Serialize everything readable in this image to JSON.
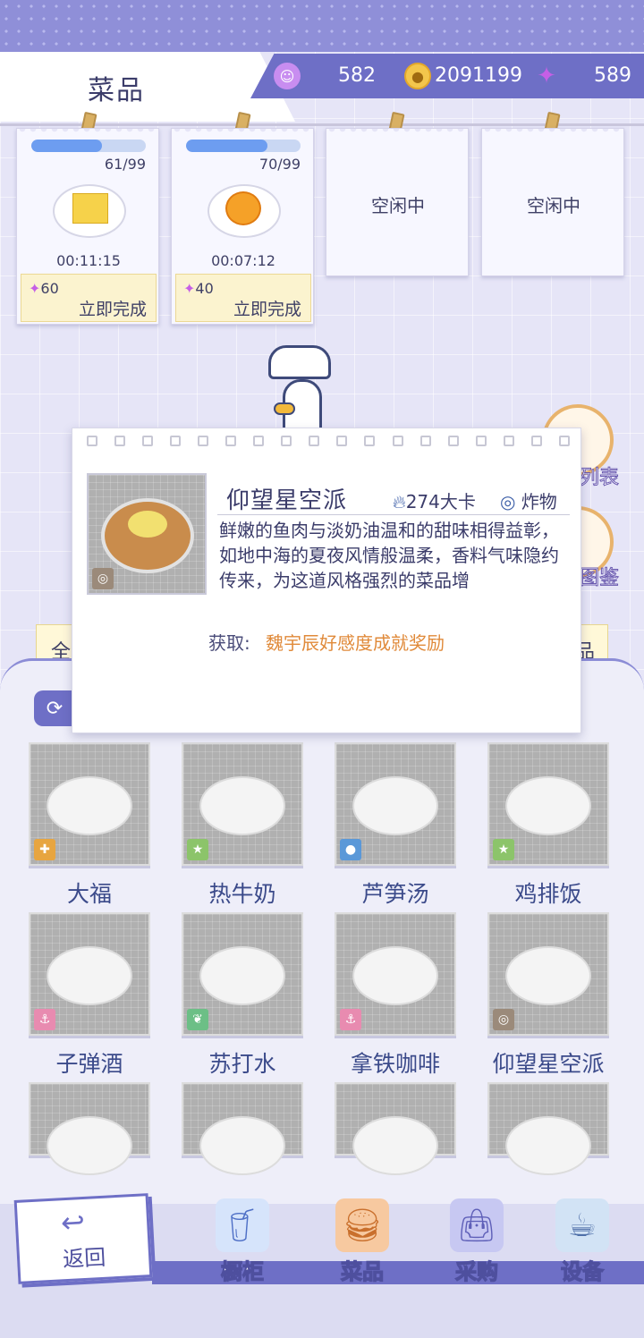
{
  "header": {
    "title": "菜品",
    "resources": [
      {
        "icon": "smile-gem-icon",
        "value": "582"
      },
      {
        "icon": "coin-icon",
        "value": "2091199"
      },
      {
        "icon": "crystal-plus-icon",
        "value": "589"
      }
    ]
  },
  "slots": [
    {
      "state": "cooking",
      "count": "61/99",
      "progress": 0.62,
      "timer": "00:11:15",
      "cost": "60",
      "finish_label": "立即完成",
      "dish_icon": "butter-plate-icon"
    },
    {
      "state": "cooking",
      "count": "70/99",
      "progress": 0.71,
      "timer": "00:07:12",
      "cost": "40",
      "finish_label": "立即完成",
      "dish_icon": "orange-plate-icon"
    },
    {
      "state": "idle",
      "label": "空闲中"
    },
    {
      "state": "idle",
      "label": "空闲中"
    }
  ],
  "side_buttons": [
    {
      "label": "列表",
      "icon": "list-icon"
    },
    {
      "label": "图鉴",
      "icon": "book-icon"
    }
  ],
  "category_tabs": [
    {
      "label": "全"
    },
    {
      "label": "品"
    }
  ],
  "popup": {
    "name": "仰望星空派",
    "calories": "274大卡",
    "type": "炸物",
    "description": "鲜嫩的鱼肉与淡奶油温和的甜味相得益彰，如地中海的夏夜风情般温柔，香料气味隐约传来，为这道风格强烈的菜品增",
    "obtain_label": "获取:",
    "obtain_value": "魏宇辰好感度成就奖励"
  },
  "dishes": [
    {
      "name": "大福",
      "badge": "puzzle-icon"
    },
    {
      "name": "热牛奶",
      "badge": "star-icon"
    },
    {
      "name": "芦笋汤",
      "badge": "bulb-icon"
    },
    {
      "name": "鸡排饭",
      "badge": "star-icon"
    },
    {
      "name": "子弹酒",
      "badge": "anchor-icon"
    },
    {
      "name": "苏打水",
      "badge": "leaf-icon"
    },
    {
      "name": "拿铁咖啡",
      "badge": "anchor-icon"
    },
    {
      "name": "仰望星空派",
      "badge": "shell-icon"
    },
    {
      "name": "",
      "badge": ""
    },
    {
      "name": "",
      "badge": ""
    },
    {
      "name": "",
      "badge": ""
    },
    {
      "name": "",
      "badge": ""
    }
  ],
  "nav": {
    "back": "返回",
    "items": [
      {
        "label": "橱柜",
        "icon": "drink-icon"
      },
      {
        "label": "菜品",
        "icon": "burger-icon"
      },
      {
        "label": "采购",
        "icon": "shopping-bag-icon"
      },
      {
        "label": "设备",
        "icon": "coffee-machine-icon"
      }
    ]
  }
}
